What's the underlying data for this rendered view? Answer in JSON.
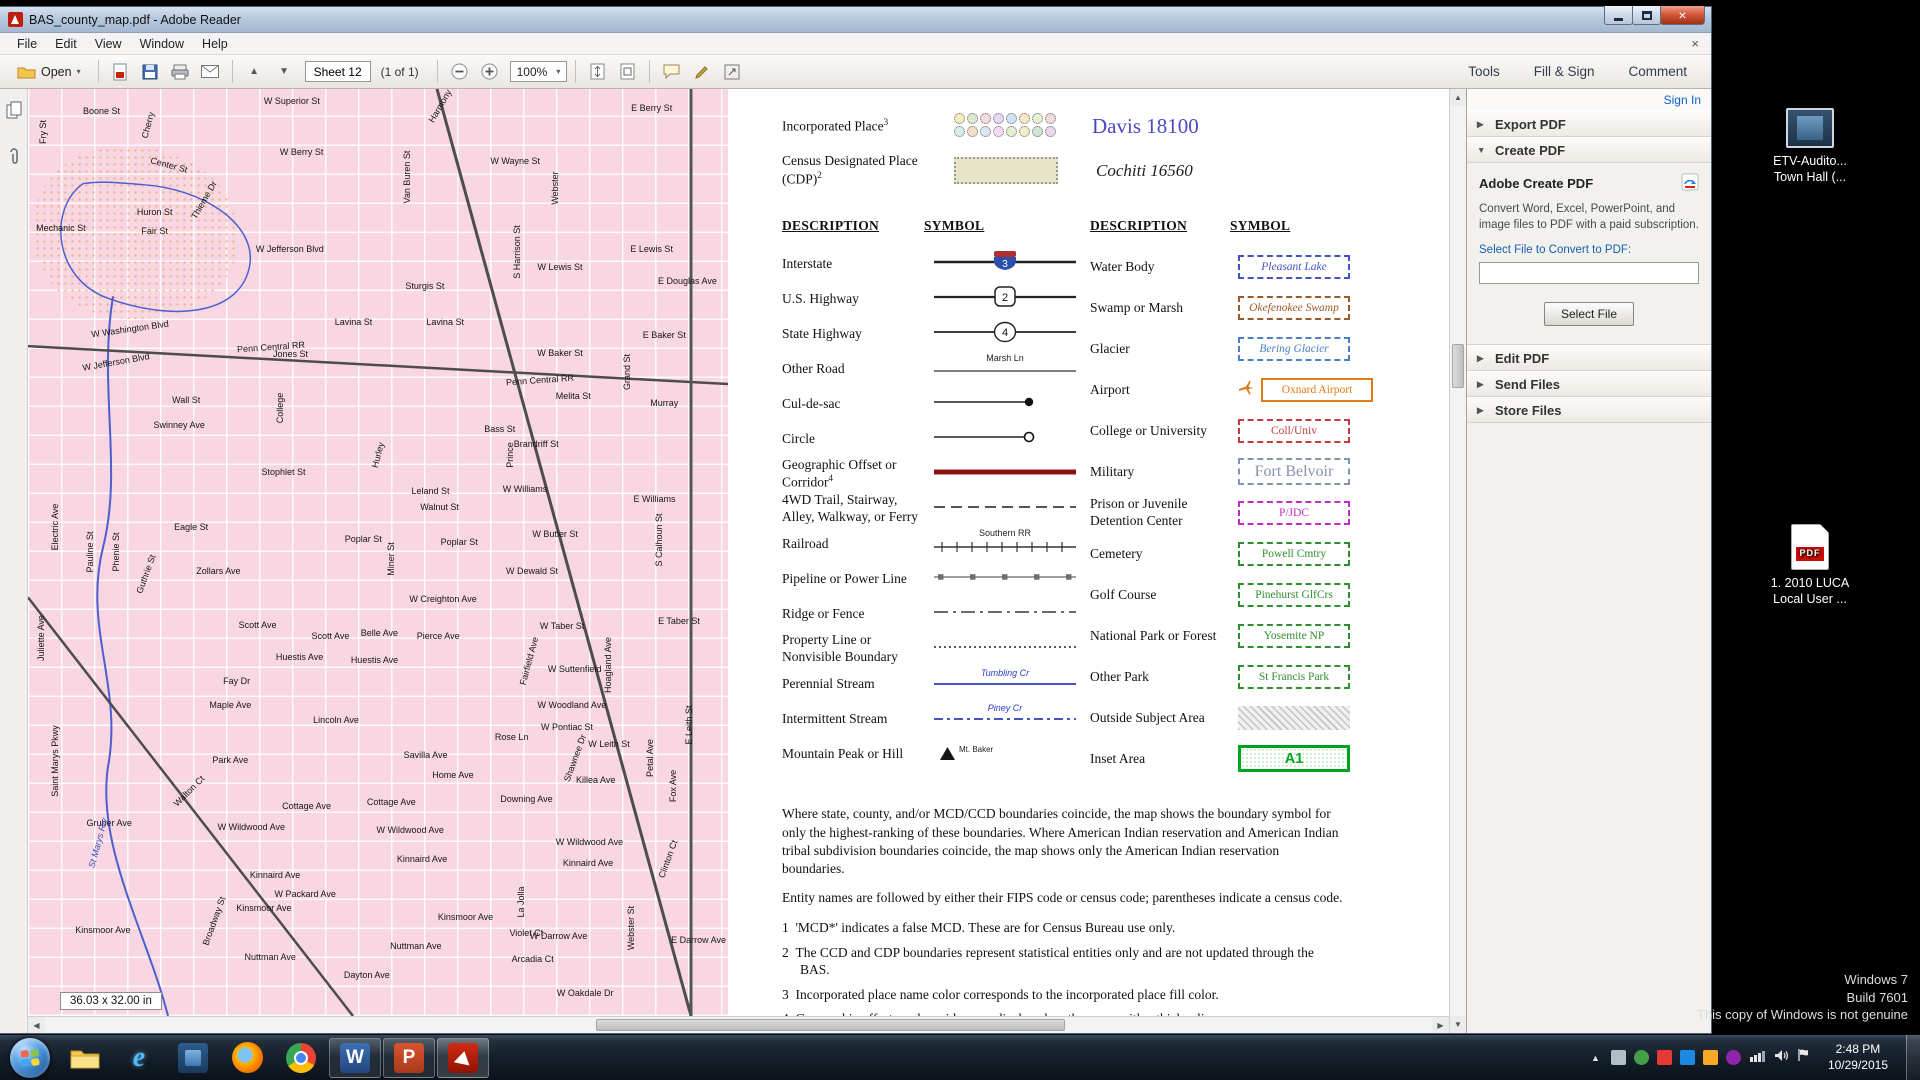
{
  "glyphs": {
    "up": "▲",
    "down": "▼",
    "left": "◀",
    "right": "▶",
    "dropdown": "▾",
    "tri_right": "▶",
    "tri_down": "▼",
    "close": "×",
    "word": "W",
    "ppt": "P",
    "ie": "e"
  },
  "window": {
    "title": "BAS_county_map.pdf - Adobe Reader",
    "menus": [
      "File",
      "Edit",
      "View",
      "Window",
      "Help"
    ],
    "toolbar": {
      "open_label": "Open",
      "page_value": "Sheet 12",
      "page_count": "(1 of 1)",
      "zoom_value": "100%",
      "tabs": [
        "Tools",
        "Fill & Sign",
        "Comment"
      ]
    }
  },
  "panel": {
    "sign_in": "Sign In",
    "sections": [
      {
        "label": "Export PDF"
      },
      {
        "label": "Create PDF"
      },
      {
        "label": "Edit PDF"
      },
      {
        "label": "Send Files"
      },
      {
        "label": "Store Files"
      }
    ],
    "create_pdf": {
      "title": "Adobe Create PDF",
      "description": "Convert Word, Excel, PowerPoint, and image files to PDF with a paid subscription.",
      "select_label": "Select File to Convert to PDF:",
      "button": "Select File"
    }
  },
  "taskbar": {
    "clock_time": "2:48 PM",
    "clock_date": "10/29/2015"
  },
  "desktop": {
    "icons": [
      {
        "label1": "ETV-Audito...",
        "label2": "Town Hall (...",
        "type": "video"
      },
      {
        "label1": "1. 2010 LUCA",
        "label2": "Local User ...",
        "type": "pdf",
        "badge": "PDF"
      }
    ],
    "notice": [
      "Windows 7",
      "Build 7601",
      "This copy of Windows is not genuine"
    ]
  },
  "document": {
    "size_indicator": "36.03 x 32.00 in",
    "legend": {
      "incorporated_place": {
        "label": "Incorporated Place",
        "sup": "3",
        "example": "Davis 18100"
      },
      "cdp": {
        "label": "Census Designated Place (CDP)",
        "sup": "2",
        "example": "Cochiti 16560"
      },
      "headers": {
        "description": "DESCRIPTION",
        "symbol": "SYMBOL"
      },
      "inc_circle_colors": [
        "#f4edc2",
        "#dcead0",
        "#f7d9e0",
        "#e4d9f0",
        "#d2e4f4",
        "#f7e8c6",
        "#e8f0d6",
        "#f0dada",
        "#d8efe8",
        "#efe0c8",
        "#dce6f5",
        "#f5dcec",
        "#e6eecf",
        "#f0f0c8",
        "#d0e8d8",
        "#ead8ea"
      ],
      "col1": [
        {
          "label": "Interstate",
          "type": "interstate",
          "sym_text": "3"
        },
        {
          "label": "U.S. Highway",
          "type": "us-highway",
          "sym_text": "2"
        },
        {
          "label": "State Highway",
          "type": "state-highway",
          "sym_text": "4"
        },
        {
          "label": "Other Road",
          "type": "other-road",
          "sym_text": "Marsh Ln"
        },
        {
          "label": "Cul-de-sac",
          "type": "cul-de-sac"
        },
        {
          "label": "Circle",
          "type": "circle"
        },
        {
          "label": "Geographic Offset or Corridor",
          "sup": "4",
          "type": "offset"
        },
        {
          "label": "4WD Trail, Stairway, Alley, Walkway, or Ferry",
          "type": "trail"
        },
        {
          "label": "Railroad",
          "type": "railroad",
          "sym_text": "Southern RR"
        },
        {
          "label": "Pipeline or Power Line",
          "type": "pipeline"
        },
        {
          "label": "Ridge or Fence",
          "type": "ridge"
        },
        {
          "label": "Property Line or Nonvisible Boundary",
          "type": "property"
        },
        {
          "label": "Perennial Stream",
          "type": "perennial",
          "sym_text": "Tumbling Cr"
        },
        {
          "label": "Intermittent Stream",
          "type": "intermittent",
          "sym_text": "Piney Cr"
        },
        {
          "label": "Mountain Peak or Hill",
          "type": "peak",
          "sym_text": "Mt. Baker"
        }
      ],
      "col2": [
        {
          "label": "Water Body",
          "type": "water",
          "sym_text": "Pleasant Lake"
        },
        {
          "label": "Swamp or Marsh",
          "type": "swamp",
          "sym_text": "Okefenokee Swamp"
        },
        {
          "label": "Glacier",
          "type": "glacier",
          "sym_text": "Bering Glacier"
        },
        {
          "label": "Airport",
          "type": "airport",
          "sym_text": "Oxnard Airport"
        },
        {
          "label": "College or University",
          "type": "college",
          "sym_text": "Coll/Univ"
        },
        {
          "label": "Military",
          "type": "military",
          "sym_text": "Fort Belvoir"
        },
        {
          "label": "Prison or Juvenile Detention Center",
          "type": "prison",
          "sym_text": "P/JDC"
        },
        {
          "label": "Cemetery",
          "type": "cemetery",
          "sym_text": "Powell Cmtry"
        },
        {
          "label": "Golf Course",
          "type": "golf",
          "sym_text": "Pinehurst GlfCrs"
        },
        {
          "label": "National Park or Forest",
          "type": "npark",
          "sym_text": "Yosemite NP"
        },
        {
          "label": "Other Park",
          "type": "opark",
          "sym_text": "St Francis Park"
        },
        {
          "label": "Outside Subject Area",
          "type": "outside"
        },
        {
          "label": "Inset Area",
          "type": "inset",
          "sym_text": "A1"
        }
      ],
      "notes": [
        "Where state, county, and/or MCD/CCD boundaries coincide, the map shows the boundary symbol for only the highest-ranking of these boundaries.  Where American Indian reservation and American Indian tribal subdivision boundaries coincide, the map shows only the American Indian reservation boundaries.",
        "Entity names are followed by either their FIPS code or census code; parentheses indicate a census code."
      ],
      "footnotes": [
        {
          "n": "1",
          "text": "'MCD*' indicates a false MCD.  These are for Census Bureau use only."
        },
        {
          "n": "2",
          "text": "The CCD and CDP boundaries represent statistical entities only and are not updated through the BAS."
        },
        {
          "n": "3",
          "text": "Incorporated place name color corresponds to the incorporated place fill color."
        },
        {
          "n": "4",
          "text": "Geographic offsets and corridors are displayed on the maps with a thicker line."
        }
      ]
    },
    "streets": [
      [
        "Boone St",
        10.5,
        2.4,
        0
      ],
      [
        "Fry St",
        2.1,
        4.6,
        -90
      ],
      [
        "Cherry",
        17.2,
        3.9,
        -75
      ],
      [
        "W Superior St",
        37.7,
        1.3,
        0
      ],
      [
        "Harmony",
        58.8,
        1.8,
        -60
      ],
      [
        "E Berry St",
        89.1,
        2.1,
        0
      ],
      [
        "W Berry St",
        39.1,
        6.8,
        0
      ],
      [
        "W Wayne St",
        69.6,
        7.8,
        0
      ],
      [
        "Center St",
        20.2,
        8.2,
        15
      ],
      [
        "Van Buren St",
        54.2,
        9.5,
        -90
      ],
      [
        "Webster",
        75.3,
        10.7,
        -90
      ],
      [
        "Huron St",
        18.1,
        13.3,
        0
      ],
      [
        "Fair St",
        18.1,
        15.3,
        0
      ],
      [
        "Thieme Dr",
        25.1,
        12.0,
        -60
      ],
      [
        "Mechanic St",
        4.7,
        15.0,
        0
      ],
      [
        "W Jefferson Blvd",
        37.4,
        17.3,
        0
      ],
      [
        "E Lewis St",
        89.1,
        17.3,
        0
      ],
      [
        "W Lewis St",
        76.0,
        19.2,
        0
      ],
      [
        "E Douglas Ave",
        94.2,
        20.7,
        0
      ],
      [
        "Sturgis St",
        56.7,
        21.2,
        0
      ],
      [
        "W Washington Blvd",
        14.6,
        25.9,
        -8
      ],
      [
        "Lavina St",
        46.5,
        25.1,
        0
      ],
      [
        "Lavina St",
        59.6,
        25.1,
        0
      ],
      [
        "W Jefferson Blvd",
        12.6,
        29.5,
        -10
      ],
      [
        "Penn Central RR",
        34.7,
        27.8,
        -4
      ],
      [
        "E Baker St",
        90.9,
        26.5,
        0
      ],
      [
        "W Baker St",
        76.0,
        28.5,
        0
      ],
      [
        "Jones St",
        37.5,
        28.6,
        0
      ],
      [
        "Penn Central RR",
        73.2,
        31.4,
        -4
      ],
      [
        "Grand St",
        85.6,
        30.5,
        -90
      ],
      [
        "Wall St",
        22.6,
        33.5,
        0
      ],
      [
        "Murray",
        90.9,
        33.9,
        0
      ],
      [
        "Melita St",
        77.9,
        33.1,
        0
      ],
      [
        "Swinney Ave",
        21.6,
        36.2,
        0
      ],
      [
        "Bass St",
        67.4,
        36.7,
        0
      ],
      [
        "Brandriff St",
        72.6,
        38.3,
        0
      ],
      [
        "College",
        36.0,
        34.4,
        -90
      ],
      [
        "Stophlet St",
        36.5,
        41.3,
        0
      ],
      [
        "Prince",
        68.9,
        39.5,
        -90
      ],
      [
        "Hurley",
        50.0,
        39.5,
        -75
      ],
      [
        "Leland St",
        57.5,
        43.4,
        0
      ],
      [
        "Walnut St",
        58.8,
        45.1,
        0
      ],
      [
        "W Williams",
        71.0,
        43.1,
        0
      ],
      [
        "E Williams",
        89.5,
        44.2,
        0
      ],
      [
        "W Butler St",
        75.3,
        48.0,
        0
      ],
      [
        "Eagle St",
        23.3,
        47.3,
        0
      ],
      [
        "Poplar St",
        47.9,
        48.5,
        0
      ],
      [
        "Poplar St",
        61.6,
        48.9,
        0
      ],
      [
        "Electric Ave",
        3.9,
        47.3,
        -90
      ],
      [
        "Pauline St",
        8.9,
        49.9,
        -90
      ],
      [
        "Phenie St",
        12.5,
        49.9,
        -90
      ],
      [
        "Miner St",
        51.9,
        50.7,
        -90
      ],
      [
        "Zollars Ave",
        27.2,
        52.0,
        0
      ],
      [
        "Guthrie St",
        16.8,
        52.3,
        -70
      ],
      [
        "W Dewald St",
        72.0,
        52.0,
        0
      ],
      [
        "W Creighton Ave",
        59.3,
        55.0,
        0
      ],
      [
        "Scott Ave",
        32.8,
        57.8,
        0
      ],
      [
        "Scott Ave",
        43.2,
        59.0,
        0
      ],
      [
        "Belle Ave",
        50.2,
        58.7,
        0
      ],
      [
        "Pierce Ave",
        58.6,
        59.0,
        0
      ],
      [
        "W Taber St",
        76.3,
        57.9,
        0
      ],
      [
        "E Taber St",
        93.0,
        57.4,
        0
      ],
      [
        "Huestis Ave",
        38.8,
        61.3,
        0
      ],
      [
        "Huestis Ave",
        49.5,
        61.6,
        0
      ],
      [
        "Fairfield Ave",
        71.6,
        61.7,
        -75
      ],
      [
        "W Suttenfield",
        78.1,
        62.6,
        0
      ],
      [
        "Fay Dr",
        29.8,
        63.9,
        0
      ],
      [
        "Maple Ave",
        28.9,
        66.4,
        0
      ],
      [
        "W Woodland Ave",
        77.7,
        66.5,
        0
      ],
      [
        "Lincoln Ave",
        44.0,
        68.1,
        0
      ],
      [
        "W Pontiac St",
        77.0,
        68.8,
        0
      ],
      [
        "W Leith St",
        83.0,
        70.7,
        0
      ],
      [
        "E Leith St",
        94.4,
        68.6,
        -90
      ],
      [
        "Rose Ln",
        69.1,
        69.9,
        0
      ],
      [
        "Savilla Ave",
        56.8,
        71.8,
        0
      ],
      [
        "Shawnee Dr",
        78.2,
        72.2,
        -70
      ],
      [
        "Killea Ave",
        81.1,
        74.5,
        0
      ],
      [
        "Park Ave",
        28.9,
        72.4,
        0
      ],
      [
        "Home Ave",
        60.7,
        74.0,
        0
      ],
      [
        "Walton Ct",
        23.0,
        75.7,
        -45
      ],
      [
        "Cottage Ave",
        39.8,
        77.3,
        0
      ],
      [
        "Cottage Ave",
        51.9,
        76.9,
        0
      ],
      [
        "Downing Ave",
        71.2,
        76.6,
        0
      ],
      [
        "Petal Ave",
        88.8,
        72.2,
        -90
      ],
      [
        "Gruber Ave",
        11.6,
        79.2,
        0
      ],
      [
        "W Wildwood Ave",
        31.9,
        79.6,
        0
      ],
      [
        "W Wildwood Ave",
        54.6,
        79.9,
        0
      ],
      [
        "W Wildwood Ave",
        80.2,
        81.2,
        0
      ],
      [
        "Kinnaird Ave",
        35.3,
        84.8,
        0
      ],
      [
        "Kinnaird Ave",
        56.3,
        83.1,
        0
      ],
      [
        "Kinnaird Ave",
        80.0,
        83.5,
        0
      ],
      [
        "Clinton Ct",
        91.4,
        83.1,
        -70
      ],
      [
        "Kinsmoor Ave",
        33.7,
        88.4,
        0
      ],
      [
        "Kinsmoor Ave",
        62.5,
        89.3,
        0
      ],
      [
        "W Packard Ave",
        39.6,
        86.8,
        0
      ],
      [
        "La Jolla",
        70.4,
        87.7,
        -90
      ],
      [
        "Broadway St",
        26.5,
        89.7,
        -70
      ],
      [
        "Kinsmoor Ave",
        10.7,
        90.7,
        0
      ],
      [
        "Nuttman Ave",
        34.6,
        93.6,
        0
      ],
      [
        "Nuttman Ave",
        55.4,
        92.5,
        0
      ],
      [
        "Violet Ct",
        71.2,
        91.0,
        0
      ],
      [
        "W Darrow Ave",
        75.8,
        91.4,
        0
      ],
      [
        "E Darrow Ave",
        95.8,
        91.8,
        0
      ],
      [
        "Arcadia Ct",
        72.1,
        93.9,
        0
      ],
      [
        "Dayton Ave",
        48.4,
        95.6,
        0
      ],
      [
        "W Oakdale Dr",
        79.6,
        97.5,
        0
      ],
      [
        "Webster St",
        86.1,
        90.5,
        -90
      ],
      [
        "S Calhoun St",
        90.2,
        48.6,
        -90
      ],
      [
        "S Harrison St",
        69.8,
        17.6,
        -90
      ],
      [
        "Hoagland Ave",
        82.8,
        62.1,
        -90
      ],
      [
        "Fox Ave",
        92.1,
        75.2,
        -90
      ],
      [
        "Juliette Ave",
        1.9,
        59.2,
        -90
      ],
      [
        "Saint Marys Pkwy",
        3.9,
        72.5,
        -90
      ],
      [
        "St Marys Riv",
        10.0,
        81.3,
        -75,
        1
      ]
    ]
  }
}
